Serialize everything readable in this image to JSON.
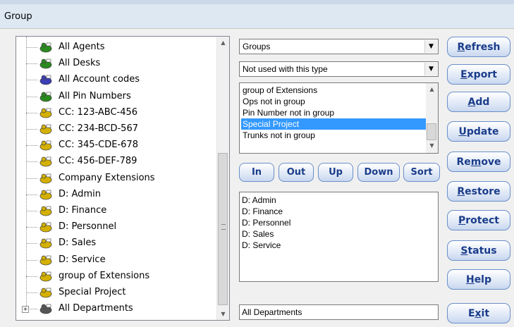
{
  "window": {
    "title": "Group"
  },
  "tree": {
    "items": [
      {
        "label": "All Agents",
        "icon": "agents-icon",
        "color": "#2a8a1e"
      },
      {
        "label": "All Desks",
        "icon": "desk-icon",
        "color": "#2a8a1e"
      },
      {
        "label": "All Account codes",
        "icon": "account-codes-icon",
        "color": "#3b3fb5"
      },
      {
        "label": "All Pin Numbers",
        "icon": "pin-numbers-icon",
        "color": "#2a8a1e"
      },
      {
        "label": "CC: 123-ABC-456",
        "icon": "phone-group-icon",
        "color": "#d4b100"
      },
      {
        "label": "CC: 234-BCD-567",
        "icon": "phone-group-icon",
        "color": "#d4b100"
      },
      {
        "label": "CC: 345-CDE-678",
        "icon": "phone-group-icon",
        "color": "#d4b100"
      },
      {
        "label": "CC: 456-DEF-789",
        "icon": "phone-group-icon",
        "color": "#d4b100"
      },
      {
        "label": "Company Extensions",
        "icon": "phone-group-icon",
        "color": "#d4b100"
      },
      {
        "label": "D: Admin",
        "icon": "phone-group-icon",
        "color": "#d4b100"
      },
      {
        "label": "D: Finance",
        "icon": "phone-group-icon",
        "color": "#d4b100"
      },
      {
        "label": "D: Personnel",
        "icon": "phone-group-icon",
        "color": "#d4b100"
      },
      {
        "label": "D: Sales",
        "icon": "phone-group-icon",
        "color": "#d4b100"
      },
      {
        "label": "D: Service",
        "icon": "phone-group-icon",
        "color": "#d4b100"
      },
      {
        "label": "group of Extensions",
        "icon": "phone-group-icon",
        "color": "#d4b100"
      },
      {
        "label": "Special Project",
        "icon": "phone-group-icon",
        "color": "#d4b100"
      },
      {
        "label": "All Departments",
        "icon": "departments-tree-icon",
        "color": "#555555"
      }
    ]
  },
  "selects": {
    "group_type": "Groups",
    "usage": "Not used with this type"
  },
  "listbox": {
    "items": [
      "group of Extensions",
      "Ops not in group",
      "Pin Number not in group",
      "Special Project",
      "Trunks not in group"
    ],
    "selected_index": 3
  },
  "move_buttons": {
    "in": "In",
    "out": "Out",
    "up": "Up",
    "down": "Down",
    "sort": "Sort"
  },
  "members": [
    "D: Admin",
    "D: Finance",
    "D: Personnel",
    "D: Sales",
    "D: Service"
  ],
  "name_field": "All Departments",
  "actions": {
    "refresh": {
      "pre": "",
      "u": "R",
      "post": "efresh"
    },
    "export": {
      "pre": "",
      "u": "E",
      "post": "xport"
    },
    "add": {
      "pre": "",
      "u": "A",
      "post": "dd"
    },
    "update": {
      "pre": "",
      "u": "U",
      "post": "pdate"
    },
    "remove": {
      "pre": "Re",
      "u": "m",
      "post": "ove"
    },
    "restore": {
      "pre": "",
      "u": "R",
      "post": "estore"
    },
    "protect": {
      "pre": "",
      "u": "P",
      "post": "rotect"
    },
    "status": {
      "pre": "",
      "u": "S",
      "post": "tatus"
    },
    "help": {
      "pre": "",
      "u": "H",
      "post": "elp"
    },
    "exit": {
      "pre": "E",
      "u": "x",
      "post": "it"
    }
  },
  "colors": {
    "selection": "#3399ff",
    "button_text": "#1a3c8a",
    "button_border": "#6a8fc8"
  }
}
